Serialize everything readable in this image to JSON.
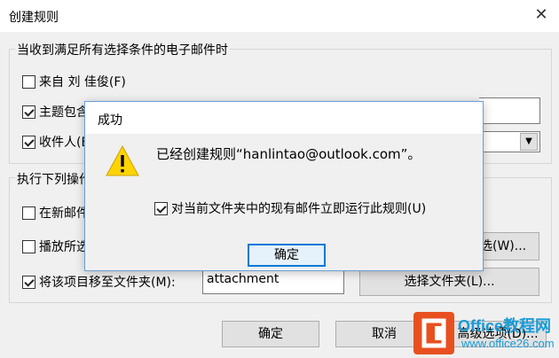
{
  "window": {
    "title": "创建规则"
  },
  "conditions": {
    "label": "当收到满足所有选择条件的电子邮件时",
    "items": [
      {
        "label": "来自 刘 佳俊(F)",
        "checked": false
      },
      {
        "label": "主题包含",
        "checked": true
      },
      {
        "label": "收件人(E",
        "checked": true
      }
    ]
  },
  "actions": {
    "label": "执行下列操作",
    "items": [
      {
        "label": "在新邮件",
        "checked": false
      },
      {
        "label": "播放所选",
        "checked": false
      },
      {
        "label": "将该项目移至文件夹(M):",
        "checked": true
      }
    ],
    "browse_partial": "选(W)...",
    "folder_value": "attachment",
    "select_folder": "选择文件夹(L)..."
  },
  "footer": {
    "ok": "确定",
    "cancel": "取消",
    "advanced": "高级选项(D)..."
  },
  "modal": {
    "title": "成功",
    "message": "已经创建规则“hanlintao@outlook.com”。",
    "checkbox_label": "对当前文件夹中的现有邮件立即运行此规则(U)",
    "checkbox_checked": true,
    "ok": "确定",
    "icon": "warning-icon"
  },
  "watermark": {
    "line1": "Office教程网",
    "line2": "www.office26.com"
  }
}
